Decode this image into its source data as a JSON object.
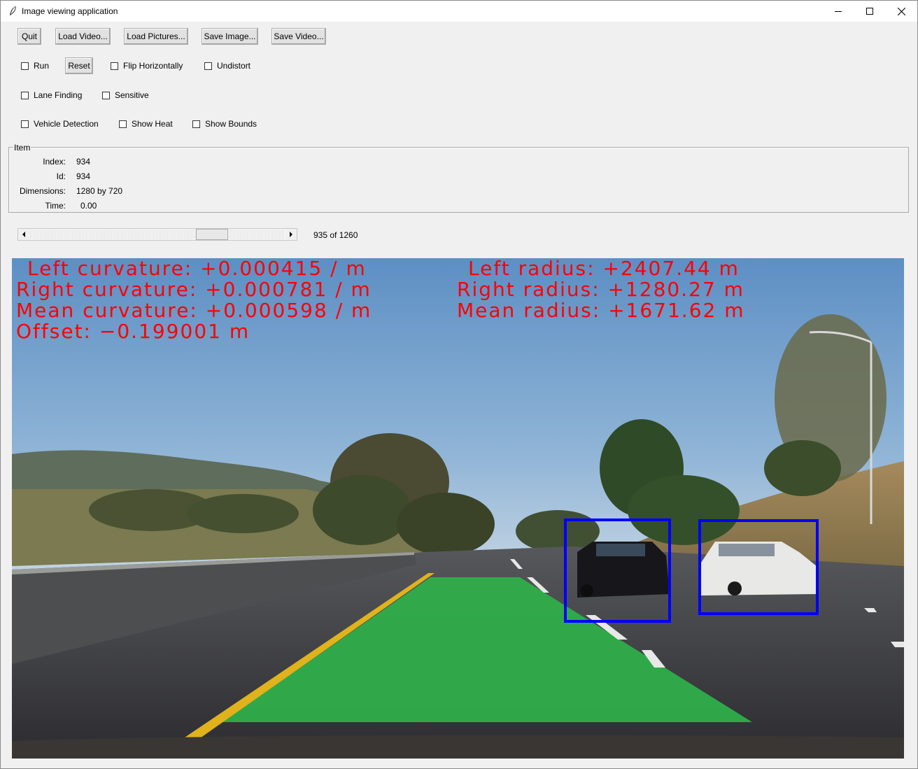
{
  "window": {
    "title": "Image viewing application",
    "controls": {
      "minimize": "minimize-icon",
      "maximize": "maximize-icon",
      "close": "close-icon"
    }
  },
  "toolbar": {
    "quit": "Quit",
    "load_video": "Load Video...",
    "load_pictures": "Load Pictures...",
    "save_image": "Save Image...",
    "save_video": "Save Video..."
  },
  "options": {
    "run": "Run",
    "reset": "Reset",
    "flip_horizontally": "Flip Horizontally",
    "undistort": "Undistort",
    "lane_finding": "Lane Finding",
    "sensitive": "Sensitive",
    "vehicle_detection": "Vehicle Detection",
    "show_heat": "Show Heat",
    "show_bounds": "Show Bounds"
  },
  "item": {
    "legend": "Item",
    "index_label": "Index:",
    "index": "934",
    "id_label": "Id:",
    "id": "934",
    "dimensions_label": "Dimensions:",
    "dimensions": "1280 by 720",
    "time_label": "Time:",
    "time": "0.00"
  },
  "navigation": {
    "position_text": "935 of 1260",
    "position_fraction": 0.742
  },
  "frame_overlay": {
    "left_curvature": "Left curvature: +0.000415 / m",
    "right_curvature": "Right curvature: +0.000781 / m",
    "mean_curvature": "Mean curvature: +0.000598 / m",
    "offset": "Offset: −0.199001 m",
    "left_radius": "Left radius: +2407.44 m",
    "right_radius": "Right radius: +1280.27 m",
    "mean_radius": "Mean radius: +1671.62 m",
    "text_color": "#ff0000",
    "lane_color": "#2fae4a",
    "bbox_color": "#0000ff"
  }
}
